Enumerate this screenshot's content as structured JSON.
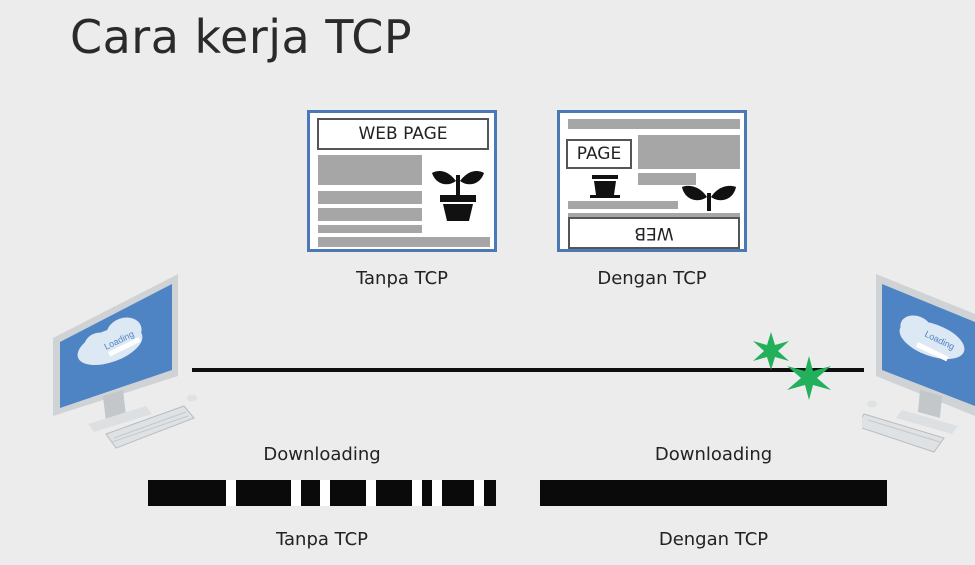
{
  "slide": {
    "title": "Cara kerja TCP"
  },
  "pages": {
    "without": {
      "header": "WEB PAGE",
      "caption": "Tanpa TCP"
    },
    "with": {
      "piece1": "PAGE",
      "piece2": "WEB",
      "caption": "Dengan TCP"
    }
  },
  "monitors": {
    "left_screen_text": "Loading",
    "right_screen_text": "Loading"
  },
  "downloads": {
    "without": {
      "label": "Downloading",
      "caption": "Tanpa TCP"
    },
    "with": {
      "label": "Downloading",
      "caption": "Dengan TCP"
    }
  },
  "colors": {
    "frame_blue": "#4a79b5",
    "screen_blue": "#4f84c4",
    "burst_green": "#22b05a",
    "placeholder_gray": "#a6a6a6"
  },
  "icons": [
    "plant-pot-icon",
    "monitor-icon",
    "keyboard-icon",
    "cloud-icon",
    "burst-icon"
  ]
}
